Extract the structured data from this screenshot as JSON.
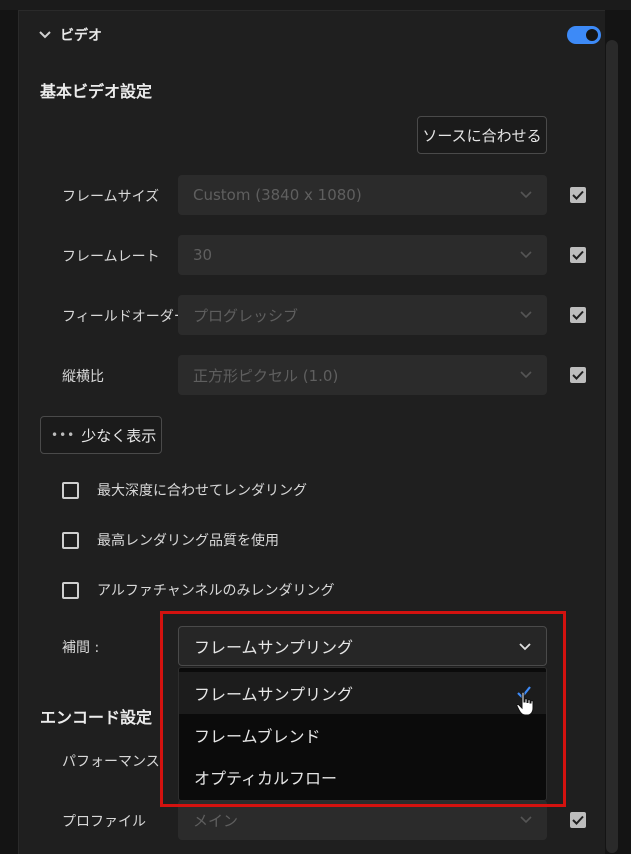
{
  "section": {
    "title": "ビデオ",
    "enabled": true
  },
  "basic_video": {
    "heading": "基本ビデオ設定",
    "match_source_label": "ソースに合わせる",
    "rows": [
      {
        "label": "フレームサイズ",
        "value": "Custom (3840 x 1080)",
        "checked": true
      },
      {
        "label": "フレームレート",
        "value": "30",
        "checked": true
      },
      {
        "label": "フィールドオーダー",
        "value": "プログレッシブ",
        "checked": true
      },
      {
        "label": "縦横比",
        "value": "正方形ピクセル (1.0)",
        "checked": true
      }
    ],
    "show_less_label": "少なく表示"
  },
  "options": [
    {
      "label": "最大深度に合わせてレンダリング",
      "checked": false
    },
    {
      "label": "最高レンダリング品質を使用",
      "checked": false
    },
    {
      "label": "アルファチャンネルのみレンダリング",
      "checked": false
    }
  ],
  "interpolation": {
    "label": "補間 :",
    "selected": "フレームサンプリング",
    "options": [
      "フレームサンプリング",
      "フレームブレンド",
      "オプティカルフロー"
    ]
  },
  "encode": {
    "heading": "エンコード設定",
    "performance_label": "パフォーマンス",
    "profile_label": "プロファイル",
    "profile_value": "メイン",
    "profile_checked": true
  },
  "colors": {
    "accent": "#3d8af7",
    "highlight_border": "#d3120f"
  }
}
